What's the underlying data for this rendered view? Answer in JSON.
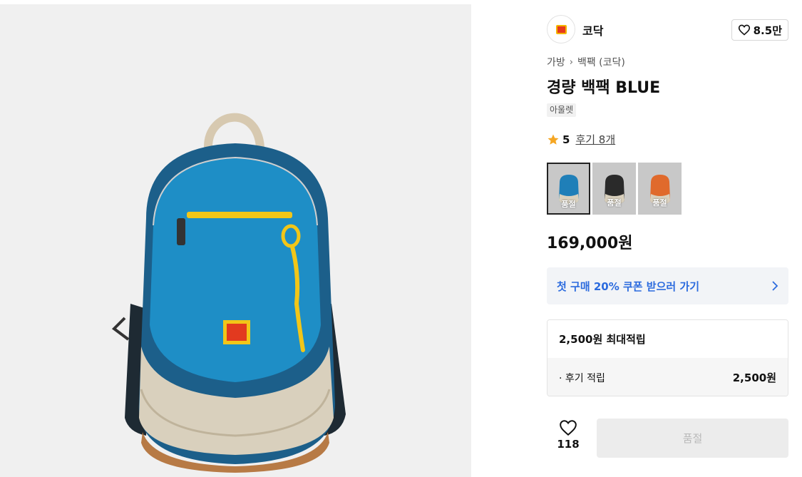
{
  "brand": {
    "name": "코닥",
    "like_count": "8.5만",
    "logo_icon": "kodak-logo"
  },
  "breadcrumb": {
    "category": "가방",
    "sub_category": "백팩 (코닥)"
  },
  "product": {
    "title": "경량 백팩 BLUE",
    "tag": "아울렛",
    "rating": "5",
    "reviews_label": "후기 8개",
    "price": "169,000원"
  },
  "swatches": [
    {
      "label": "품절",
      "color": "#1f7fb8",
      "selected": true
    },
    {
      "label": "품절",
      "color": "#2a2a2a",
      "selected": false
    },
    {
      "label": "품절",
      "color": "#e06a2c",
      "selected": false
    }
  ],
  "coupon": {
    "label": "첫 구매 20% 쿠폰 받으러 가기"
  },
  "points": {
    "title": "2,500원 최대적립",
    "rows": [
      {
        "label": "· 후기 적립",
        "value": "2,500원"
      }
    ]
  },
  "wishlist": {
    "count": "118"
  },
  "buy_button": {
    "label": "품절"
  },
  "colors": {
    "accent_blue": "#2c6bde",
    "star": "#f5a623",
    "bag_blue": "#1f7fb8"
  }
}
